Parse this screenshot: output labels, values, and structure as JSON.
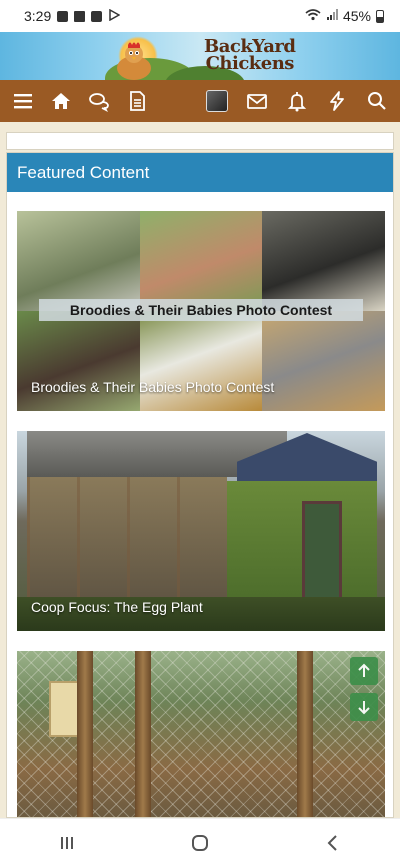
{
  "status_bar": {
    "time": "3:29",
    "battery": "45%",
    "icons": [
      "shopping-bag-icon",
      "news-icon",
      "shopping-bag-icon",
      "play-store-icon"
    ],
    "right_icons": [
      "wifi-icon",
      "signal-icon",
      "battery-icon"
    ]
  },
  "logo": {
    "line1": "BackYard",
    "line2": "Chickens"
  },
  "navbar": {
    "left_icons": [
      "menu-icon",
      "home-icon",
      "chat-icon",
      "document-icon"
    ],
    "right_icons": [
      "avatar",
      "mail-icon",
      "bell-icon",
      "lightning-icon",
      "search-icon"
    ],
    "background": "#9a5a24"
  },
  "featured": {
    "header": "Featured Content",
    "header_color": "#2a86b8",
    "items": [
      {
        "caption": "Broodies & Their Babies Photo Contest",
        "overlay_title": "Broodies & Their Babies Photo Contest"
      },
      {
        "caption": "Coop Focus: The Egg Plant"
      },
      {
        "caption": ""
      }
    ]
  },
  "scroll_buttons": {
    "up": "arrow-up-icon",
    "down": "arrow-down-icon",
    "color": "#3e8f4a"
  },
  "android_nav": {
    "recent": "recent-apps-icon",
    "home": "home-button-icon",
    "back": "back-icon"
  }
}
